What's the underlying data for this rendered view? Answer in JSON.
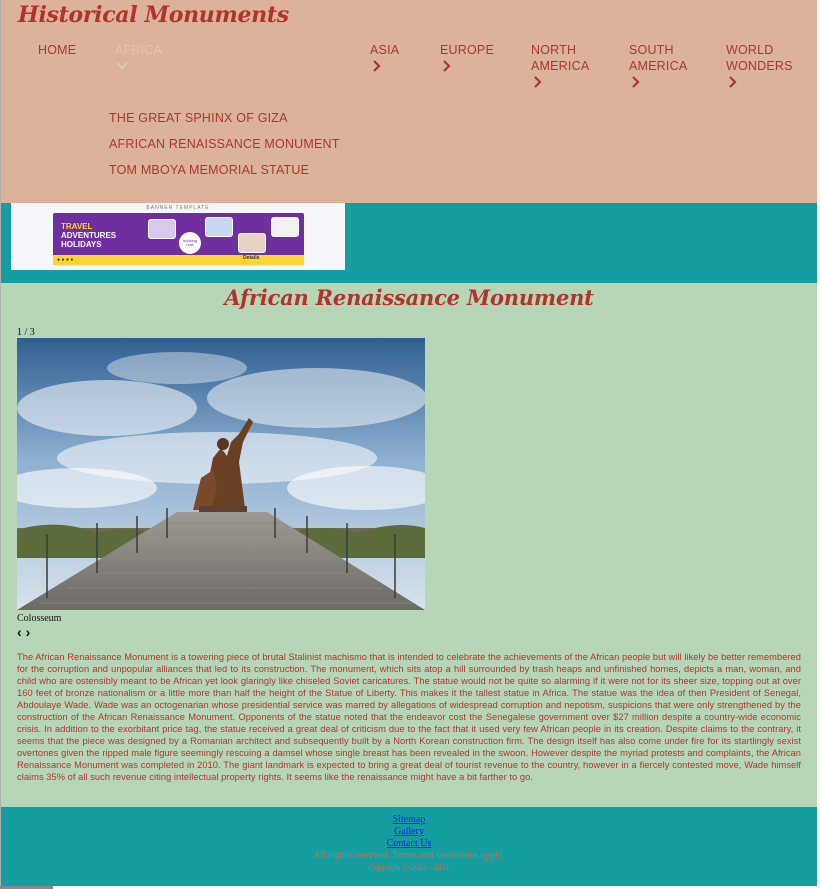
{
  "site": {
    "title": "Historical Monuments"
  },
  "nav": {
    "home": "HOME",
    "africa": "AFRICA",
    "asia": "ASIA",
    "europe": "EUROPE",
    "north_america": "NORTH AMERICA",
    "south_america": "SOUTH AMERICA",
    "world_wonders": "WORLD WONDERS",
    "africa_dropdown": [
      "THE GREAT SPHINX OF GIZA",
      "AFRICAN RENAISSANCE MONUMENT",
      "TOM MBOYA MEMORIAL STATUE"
    ]
  },
  "banner": {
    "header": "BANNER TEMPLATE",
    "line1": "TRAVEL",
    "line2": "ADVENTURES",
    "line3": "HOLIDAYS",
    "badge": "booking now",
    "cta": "Details"
  },
  "page": {
    "title": "African Renaissance Monument",
    "slide_counter": "1 / 3",
    "caption": "Colosseum",
    "prev": "‹",
    "next": "›",
    "description": "The African Renaissance Monument is a towering piece of brutal Stalinist machismo that is intended to celebrate the achievements of the African people but will likely be better remembered for the corruption and unpopular alliances that led to its construction. The monument, which sits atop a hill surrounded by trash heaps and unfinished homes, depicts a man, woman, and child who are ostensibly meant to be African yet look glaringly like chiseled Soviet caricatures. The statue would not be quite so alarming if it were not for its sheer size, topping out at over 160 feet of bronze nationalism or a little more than half the height of the Statue of Liberty. This makes it the tallest statue in Africa. The statue was the idea of then President of Senegal, Abdoulaye Wade. Wade was an octogenarian whose presidential service was marred by allegations of widespread corruption and nepotism, suspicions that were only strengthened by the construction of the African Renaissance Monument. Opponents of the statue noted that the endeavor cost the Senegalese government over $27 million despite a country-wide economic crisis. In addition to the exorbitant price tag, the statue received a great deal of criticism due to the fact that it used very few African people in its creation. Despite claims to the contrary, it seems that the piece was designed by a Romanian architect and subsequently built by a North Korean construction firm. The design itself has also come under fire for its startlingly sexist overtones given the ripped male figure seemingly rescuing a damsel whose single breast has been revealed in the swoon. However despite the myriad protests and complaints, the African Renaissance Monument was completed in 2010. The giant landmark is expected to bring a great deal of tourist revenue to the country, however in a fiercely contested move, Wade himself claims 35% of all such revenue citing intellectual property rights. It seems like the renaissance might have a bit farther to go."
  },
  "footer": {
    "sitemap": "Sitemap",
    "gallery": "Gallery",
    "contact": "Contact Us",
    "rights": "All rights reserved. Terms and conditions apply.",
    "copyright": "Copyright © 2021 - 2021"
  },
  "colors": {
    "header_bg": "#dcb29b",
    "teal": "#149ea0",
    "main_bg": "#b7d6b7",
    "accent_red": "#b3332b"
  }
}
